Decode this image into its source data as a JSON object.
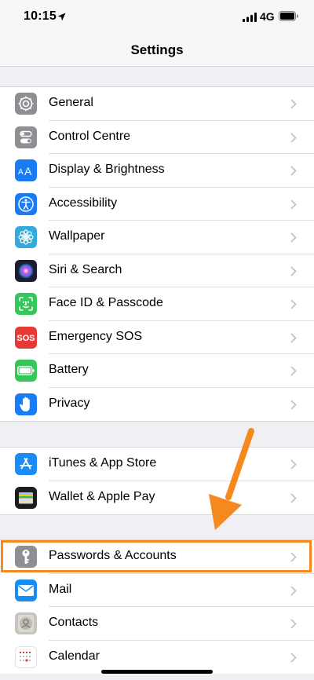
{
  "status_bar": {
    "time": "10:15",
    "network": "4G",
    "location_icon": "location-arrow-icon",
    "signal_icon": "cellular-signal-icon",
    "battery_icon": "battery-icon"
  },
  "nav": {
    "title": "Settings"
  },
  "groups": [
    {
      "items": [
        {
          "label": "General",
          "icon": "gear-icon",
          "color": "#8e8e93"
        },
        {
          "label": "Control Centre",
          "icon": "toggles-icon",
          "color": "#8e8e93"
        },
        {
          "label": "Display & Brightness",
          "icon": "text-size-icon",
          "color": "#1a7cf5"
        },
        {
          "label": "Accessibility",
          "icon": "accessibility-icon",
          "color": "#1a7cf5"
        },
        {
          "label": "Wallpaper",
          "icon": "flower-icon",
          "color": "#34aadc"
        },
        {
          "label": "Siri & Search",
          "icon": "siri-icon",
          "color": "#1c1c2e"
        },
        {
          "label": "Face ID & Passcode",
          "icon": "face-id-icon",
          "color": "#34c759"
        },
        {
          "label": "Emergency SOS",
          "icon": "sos-icon",
          "color": "#e53935"
        },
        {
          "label": "Battery",
          "icon": "battery-settings-icon",
          "color": "#34c759"
        },
        {
          "label": "Privacy",
          "icon": "hand-icon",
          "color": "#1a7cf5"
        }
      ]
    },
    {
      "items": [
        {
          "label": "iTunes & App Store",
          "icon": "app-store-icon",
          "color": "#1a8cf5"
        },
        {
          "label": "Wallet & Apple Pay",
          "icon": "wallet-icon",
          "color": "#1c1c1e"
        }
      ]
    },
    {
      "items": [
        {
          "label": "Passwords & Accounts",
          "icon": "key-icon",
          "color": "#8e8e93"
        },
        {
          "label": "Mail",
          "icon": "mail-icon",
          "color": "#1a8cf5"
        },
        {
          "label": "Contacts",
          "icon": "contacts-icon",
          "color": "#c7c4bf"
        },
        {
          "label": "Calendar",
          "icon": "calendar-icon",
          "color": "#ffffff"
        }
      ]
    }
  ],
  "annotation": {
    "highlight_color": "#f5891f",
    "highlighted_item": "Passwords & Accounts",
    "arrow_icon": "annotation-arrow-icon"
  }
}
